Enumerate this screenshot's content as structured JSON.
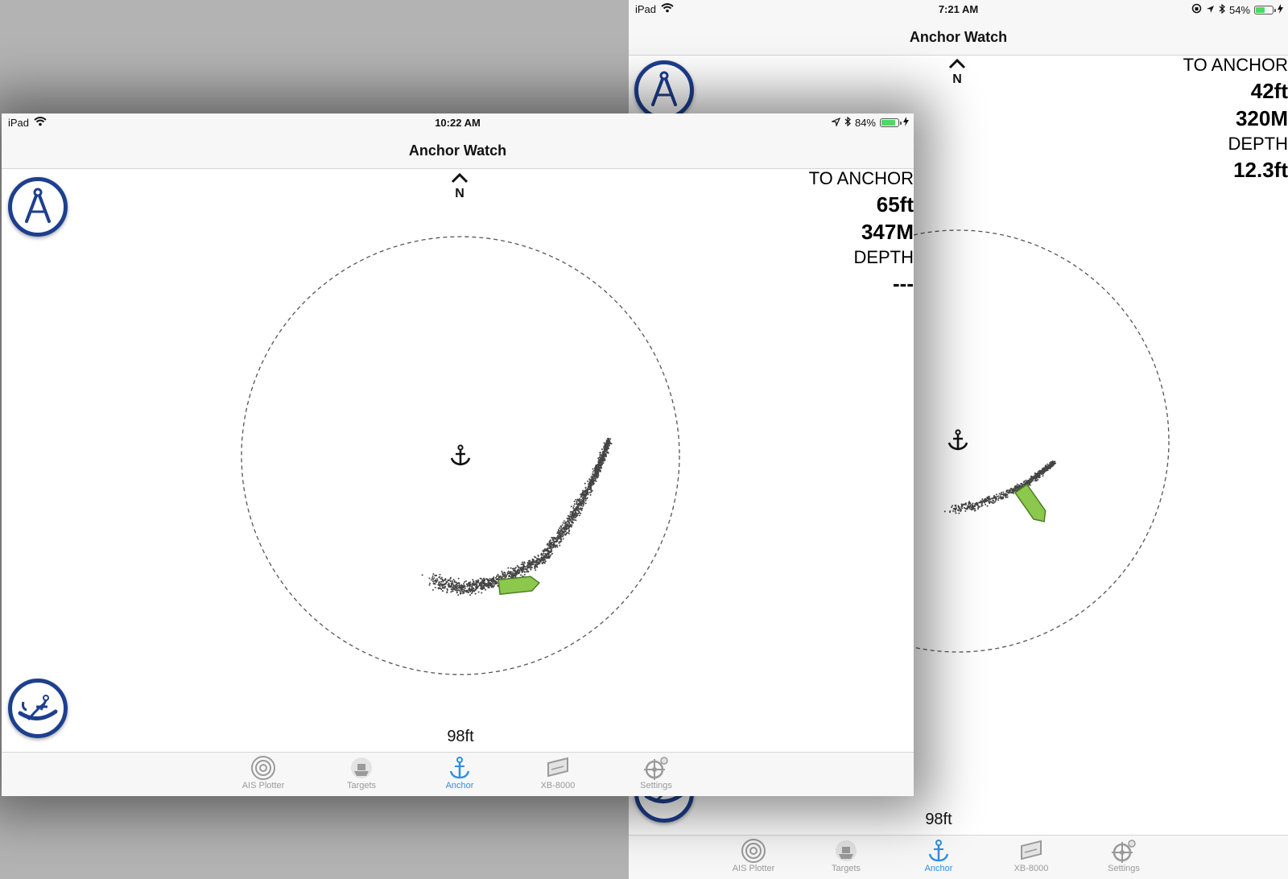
{
  "accent_color": "#2f8ee0",
  "button_color": "#1d3f8f",
  "boat_color": "#8cc84b",
  "screens": {
    "back": {
      "status": {
        "device": "iPad",
        "time": "7:21 AM",
        "battery": "54%",
        "battery_level": 0.54
      },
      "nav_title": "Anchor Watch",
      "north_label": "N",
      "readout": {
        "to_anchor_label": "TO ANCHOR",
        "distance": "42ft",
        "bearing": "320M",
        "depth_label": "DEPTH",
        "depth": "12.3ft"
      },
      "scale_label": "98ft",
      "tabs": [
        {
          "label": "AIS Plotter",
          "icon": "radar-icon"
        },
        {
          "label": "Targets",
          "icon": "ship-icon"
        },
        {
          "label": "Anchor",
          "icon": "anchor-icon"
        },
        {
          "label": "XB-8000",
          "icon": "device-icon"
        },
        {
          "label": "Settings",
          "icon": "settings-wheel-icon"
        }
      ],
      "active_tab": "Anchor"
    },
    "front": {
      "status": {
        "device": "iPad",
        "time": "10:22 AM",
        "battery": "84%",
        "battery_level": 0.84
      },
      "nav_title": "Anchor Watch",
      "north_label": "N",
      "readout": {
        "to_anchor_label": "TO ANCHOR",
        "distance": "65ft",
        "bearing": "347M",
        "depth_label": "DEPTH",
        "depth": "---"
      },
      "scale_label": "98ft",
      "tabs": [
        {
          "label": "AIS Plotter",
          "icon": "radar-icon"
        },
        {
          "label": "Targets",
          "icon": "ship-icon"
        },
        {
          "label": "Anchor",
          "icon": "anchor-icon"
        },
        {
          "label": "XB-8000",
          "icon": "device-icon"
        },
        {
          "label": "Settings",
          "icon": "settings-wheel-icon"
        }
      ],
      "active_tab": "Anchor"
    }
  }
}
